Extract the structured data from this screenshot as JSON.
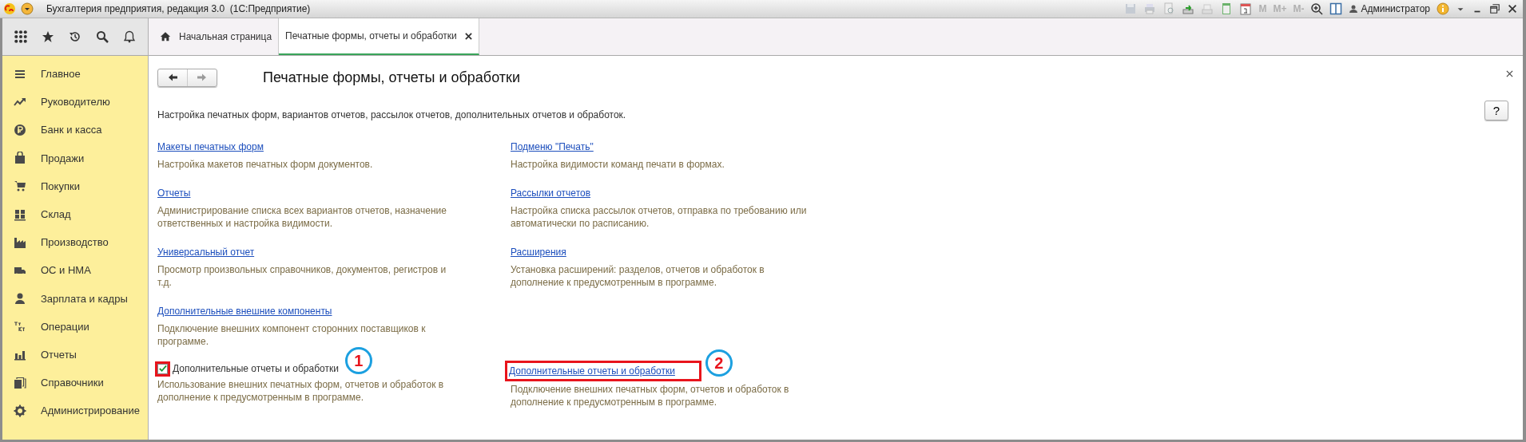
{
  "window": {
    "title": "Бухгалтерия предприятия, редакция 3.0  (1С:Предприятие)",
    "user": "Администратор",
    "memory_buttons": [
      {
        "label": "M",
        "disabled": true
      },
      {
        "label": "M+",
        "disabled": true
      },
      {
        "label": "M-",
        "disabled": true
      }
    ]
  },
  "tabs": [
    {
      "label": "Начальная страница",
      "selected": false,
      "closable": false
    },
    {
      "label": "Печатные формы, отчеты и обработки",
      "selected": true,
      "closable": true
    }
  ],
  "sidebar": {
    "items": [
      {
        "label": "Главное"
      },
      {
        "label": "Руководителю"
      },
      {
        "label": "Банк и касса"
      },
      {
        "label": "Продажи"
      },
      {
        "label": "Покупки"
      },
      {
        "label": "Склад"
      },
      {
        "label": "Производство"
      },
      {
        "label": "ОС и НМА"
      },
      {
        "label": "Зарплата и кадры"
      },
      {
        "label": "Операции"
      },
      {
        "label": "Отчеты"
      },
      {
        "label": "Справочники"
      },
      {
        "label": "Администрирование"
      }
    ]
  },
  "form": {
    "title": "Печатные формы, отчеты и обработки",
    "description": "Настройка печатных форм, вариантов отчетов, рассылок отчетов, дополнительных отчетов и обработок.",
    "help": "?",
    "rows": [
      {
        "left": {
          "kind": "link",
          "label": "Макеты печатных форм",
          "description": "Настройка макетов печатных форм документов."
        },
        "right": {
          "kind": "link",
          "label": "Подменю \"Печать\"",
          "description": "Настройка видимости команд печати в формах."
        }
      },
      {
        "left": {
          "kind": "link",
          "label": "Отчеты",
          "description": "Администрирование списка всех вариантов отчетов, назначение ответственных и настройка видимости."
        },
        "right": {
          "kind": "link",
          "label": "Рассылки отчетов",
          "description": "Настройка списка рассылок отчетов, отправка по требованию или автоматически по расписанию."
        }
      },
      {
        "left": {
          "kind": "link",
          "label": "Универсальный отчет",
          "description": "Просмотр произвольных справочников, документов, регистров и т.д."
        },
        "right": {
          "kind": "link",
          "label": "Расширения",
          "description": "Установка расширений: разделов, отчетов и обработок в дополнение к предусмотренным в программе."
        }
      },
      {
        "left": {
          "kind": "link",
          "label": "Дополнительные внешние компоненты",
          "description": "Подключение внешних компонент сторонних поставщиков к программе."
        }
      },
      {
        "left": {
          "kind": "checkbox",
          "label": "Дополнительные отчеты и обработки",
          "checked": true,
          "highlighted": true,
          "callout": "1",
          "description": "Использование внешних печатных форм, отчетов и обработок в дополнение к предусмотренным в программе."
        },
        "right": {
          "kind": "link",
          "label": "Дополнительные отчеты и обработки",
          "highlighted": true,
          "callout": "2",
          "description": "Подключение внешних печатных форм, отчетов и обработок в дополнение к предусмотренным в программе."
        }
      }
    ]
  }
}
